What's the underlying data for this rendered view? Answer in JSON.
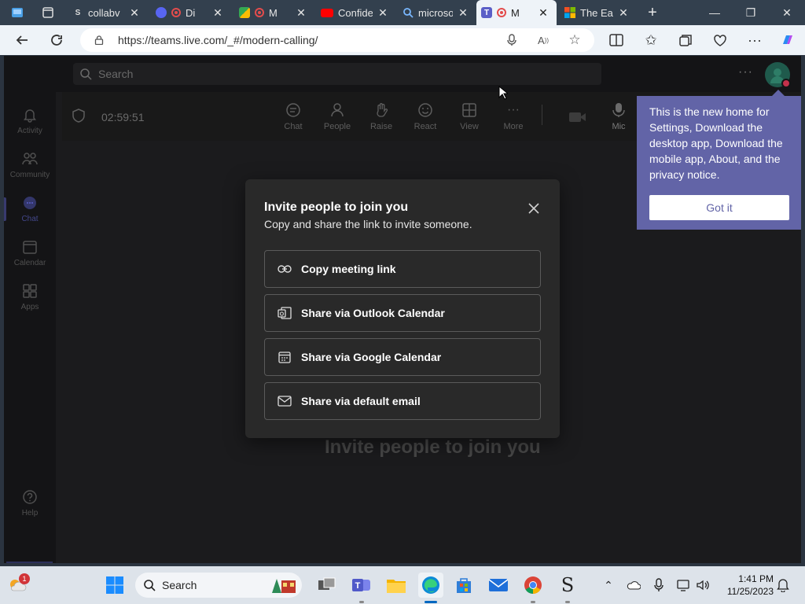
{
  "browser": {
    "tabs": [
      {
        "title": "collabv",
        "favicon": "s-logo-icon"
      },
      {
        "title": "Di",
        "favicon": "discord-icon"
      },
      {
        "title": "M",
        "favicon": "maps-icon"
      },
      {
        "title": "Confide",
        "favicon": "youtube-icon"
      },
      {
        "title": "microso",
        "favicon": "search-icon"
      },
      {
        "title": "M",
        "favicon": "teams-icon"
      },
      {
        "title": "The Ea",
        "favicon": "microsoft-icon"
      }
    ],
    "url": "https://teams.live.com/_#/modern-calling/"
  },
  "teams": {
    "search_placeholder": "Search",
    "rail": [
      {
        "label": "Activity",
        "icon": "bell-icon"
      },
      {
        "label": "Community",
        "icon": "community-icon"
      },
      {
        "label": "Chat",
        "icon": "chat-icon"
      },
      {
        "label": "Calendar",
        "icon": "calendar-icon"
      },
      {
        "label": "Apps",
        "icon": "apps-icon"
      },
      {
        "label": "Help",
        "icon": "help-icon"
      }
    ],
    "meeting": {
      "timer": "02:59:51",
      "controls": {
        "chat": "Chat",
        "people": "People",
        "raise": "Raise",
        "react": "React",
        "view": "View",
        "more": "More",
        "mic": "Mic"
      }
    },
    "stage_text": "Invite people to join you",
    "dialog": {
      "title": "Invite people to join you",
      "subtitle": "Copy and share the link to invite someone.",
      "options": [
        {
          "label": "Copy meeting link",
          "icon": "link-icon"
        },
        {
          "label": "Share via Outlook Calendar",
          "icon": "outlook-icon"
        },
        {
          "label": "Share via Google Calendar",
          "icon": "calendar-icon"
        },
        {
          "label": "Share via default email",
          "icon": "mail-icon"
        }
      ]
    },
    "tip": {
      "text": "This is the new home for Settings, Download the desktop app, Download the mobile app, About, and the privacy notice.",
      "button": "Got it"
    }
  },
  "taskbar": {
    "search_label": "Search",
    "time": "1:41 PM",
    "date": "11/25/2023",
    "notification_count": "1"
  },
  "colors": {
    "teams_purple": "#6264a7",
    "dialog_bg": "#292929",
    "app_bg": "#1b1b1d"
  }
}
